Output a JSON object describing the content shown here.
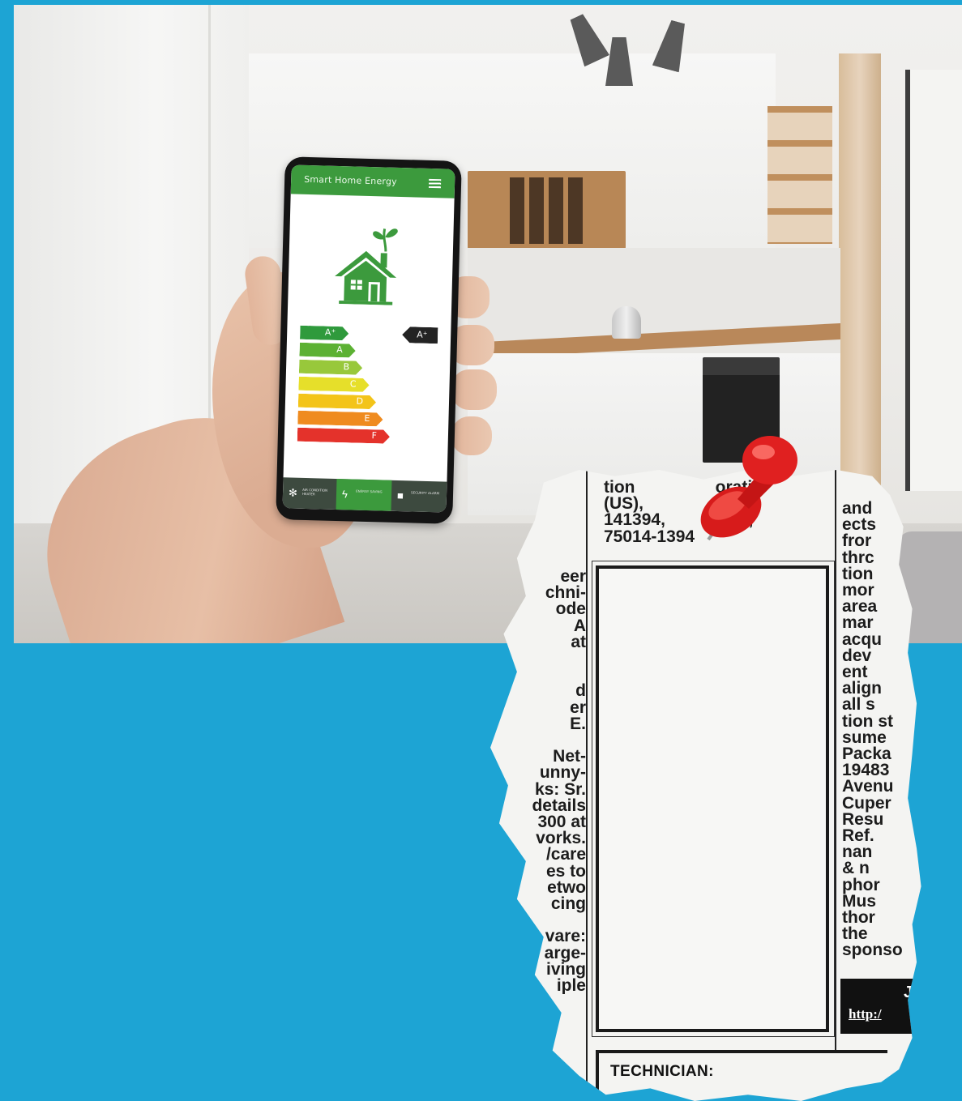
{
  "scene": {
    "background_color": "#1da4d4",
    "phone": {
      "app_title": "Smart Home Energy",
      "rating_badge": "A⁺",
      "energy_bars": [
        {
          "label": "A⁺",
          "color": "#2f9a3c"
        },
        {
          "label": "A",
          "color": "#5cb133"
        },
        {
          "label": "B",
          "color": "#98c83b"
        },
        {
          "label": "C",
          "color": "#e6df2a"
        },
        {
          "label": "D",
          "color": "#f3c419"
        },
        {
          "label": "E",
          "color": "#ef8b1f"
        },
        {
          "label": "F",
          "color": "#e4322b"
        }
      ],
      "nav": [
        {
          "icon": "snowflake-icon",
          "label": "AIR CONDITION HEATER"
        },
        {
          "icon": "lightning-icon",
          "label": "ENERGY SAVING"
        },
        {
          "icon": "lock-icon",
          "label": "SECURITY ALARM"
        }
      ]
    },
    "newspaper": {
      "top_text": "tion                 oratio\n(US),                  Box\n141394,             TX,\n75014-1394",
      "left_text": "eer\nchni-\node\nA\nat\n\n\nd\ner\nE.\n\nNet-\nunny-\nks: Sr.\ndetails\n300 at\nvorks.\n/care\nes to\netwo\ncing\n\nvare:\narge-\niving\niple",
      "right_text": "and\nects\nfror\nthrc\ntion\nmor\narea\nmar\nacqu\ndev\nent\nalign\nall s\ntion st\nsume\nPacka\n19483\nAvenu\nCuper\nResu\nRef.\nnan\n& n\nphor\nMus\nthor\nthe\nsponso",
      "job_block_title": "Jo",
      "job_block_url": "http:/",
      "technician_label": "TECHNICIAN:"
    }
  }
}
